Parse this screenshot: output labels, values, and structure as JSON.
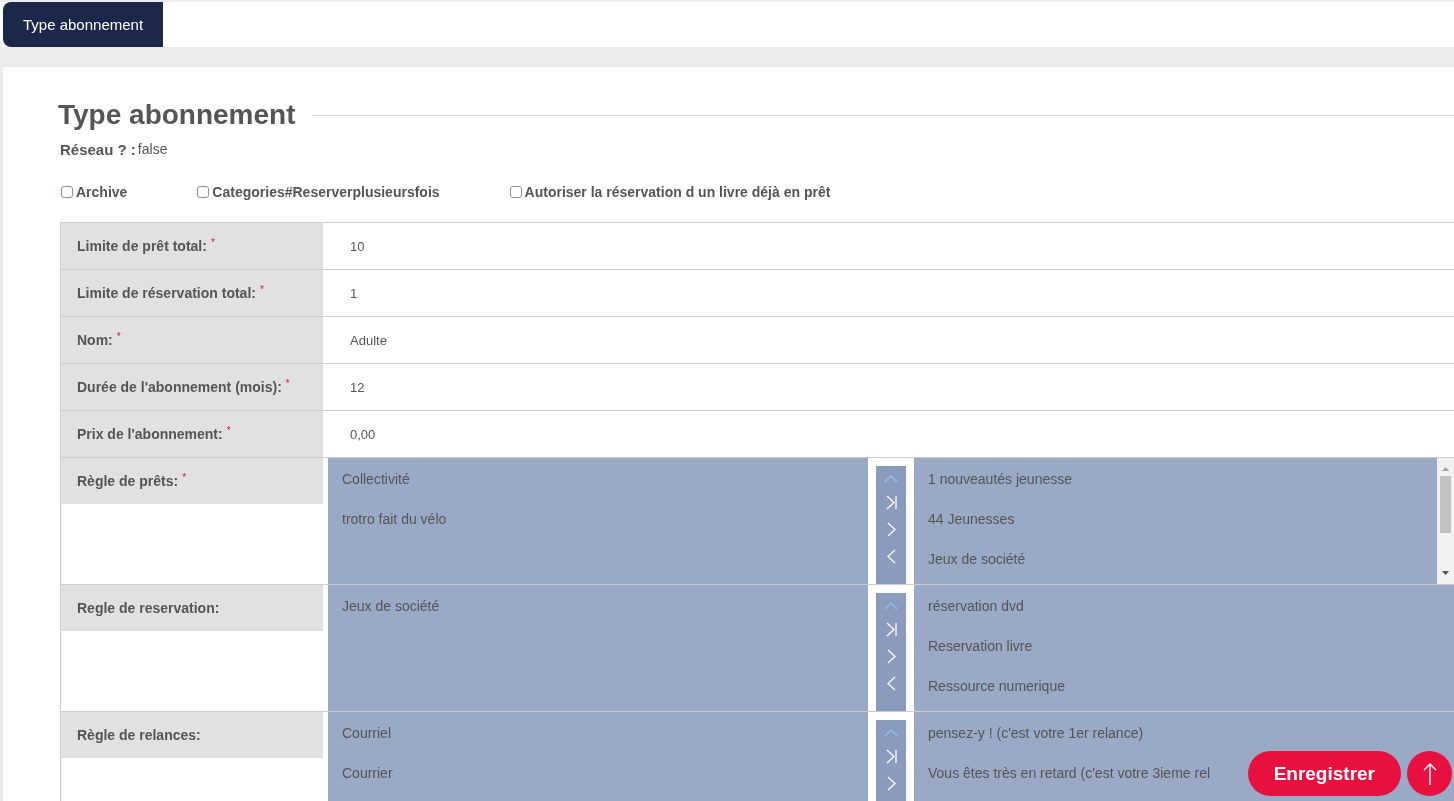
{
  "tab": {
    "label": "Type abonnement",
    "selected": true
  },
  "heading": "Type abonnement",
  "network": {
    "label": "Réseau ? :",
    "value": "false"
  },
  "checkboxes": [
    {
      "label": "Archive",
      "checked": false
    },
    {
      "label": "Categories#Reserverplusieursfois",
      "checked": false
    },
    {
      "label": "Autoriser la réservation d un livre déjà en prêt",
      "checked": false
    }
  ],
  "required_mark": "*",
  "fields": [
    {
      "kind": "input",
      "label": "Limite de prêt total:",
      "required": true,
      "value": "10"
    },
    {
      "kind": "input",
      "label": "Limite de réservation total:",
      "required": true,
      "value": "1"
    },
    {
      "kind": "input",
      "label": "Nom:",
      "required": true,
      "value": "Adulte"
    },
    {
      "kind": "input",
      "label": "Durée de l'abonnement (mois):",
      "required": true,
      "value": "12"
    },
    {
      "kind": "input",
      "label": "Prix de l'abonnement:",
      "required": true,
      "value": "0,00"
    },
    {
      "kind": "duallist",
      "label": "Règle de prêts:",
      "required": true,
      "available": [
        "Collectivité",
        "trotro fait du vélo"
      ],
      "chosen": [
        "1 nouveautés jeunesse",
        "44 Jeunesses",
        "Jeux de société"
      ],
      "scrollbar": true
    },
    {
      "kind": "duallist",
      "label": "Regle de reservation:",
      "required": false,
      "available": [
        "Jeux de société"
      ],
      "chosen": [
        "réservation dvd",
        "Reservation livre",
        "Ressource numerique"
      ],
      "scrollbar": false
    },
    {
      "kind": "duallist",
      "label": "Règle de relances:",
      "required": false,
      "available": [
        "Courriel",
        "Courrier"
      ],
      "chosen": [
        "pensez-y ! (c'est votre 1er relance)",
        "Vous êtes très en retard (c'est votre 3ieme rel"
      ],
      "scrollbar": false
    }
  ],
  "save_button": "Enregistrer"
}
